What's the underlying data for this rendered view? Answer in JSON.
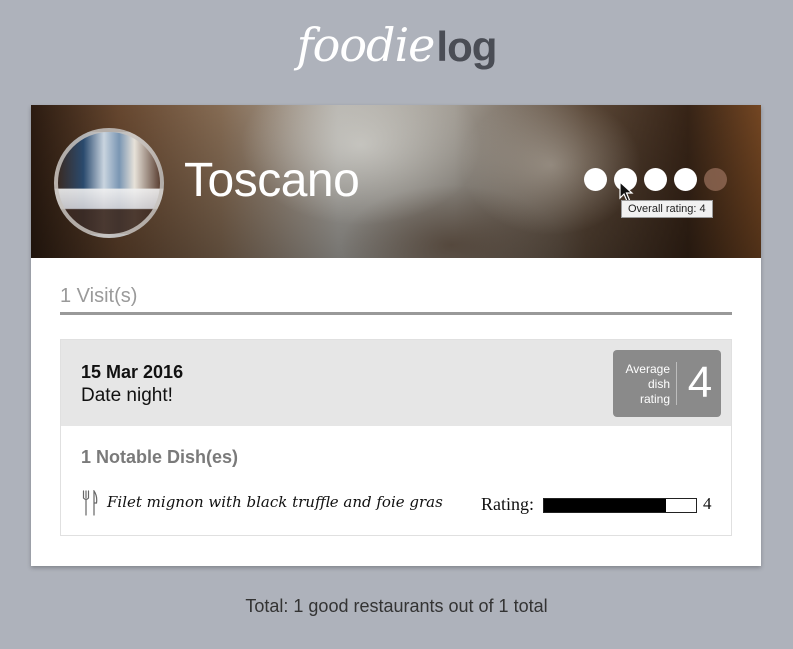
{
  "app": {
    "logo_part1": "foodie",
    "logo_part2": "log",
    "logo_colors": {
      "foodie": "#ffffff",
      "log": "#4a4d55"
    },
    "background_color": "#aeb2bb"
  },
  "restaurant": {
    "name": "Toscano",
    "avatar_icon": "restaurant-interior-photo",
    "overall_rating": 4,
    "rating_max": 5,
    "rating_tooltip": "Overall rating: 4",
    "star_colors": {
      "on": "#ffffff",
      "off": "rgba(150,110,90,0.75)"
    }
  },
  "visits": {
    "heading": "1 Visit(s)",
    "items": [
      {
        "date": "15 Mar 2016",
        "note": "Date night!",
        "average_label": "Average dish rating",
        "average_value": "4",
        "dishes_heading": "1 Notable Dish(es)",
        "dishes": [
          {
            "icon": "fork-knife-icon",
            "name": "Filet mignon with black truffle and foie gras",
            "rating_label": "Rating:",
            "rating": 4,
            "rating_max": 5
          }
        ]
      }
    ]
  },
  "footer": {
    "text": "Total: 1 good restaurants out of 1 total"
  }
}
